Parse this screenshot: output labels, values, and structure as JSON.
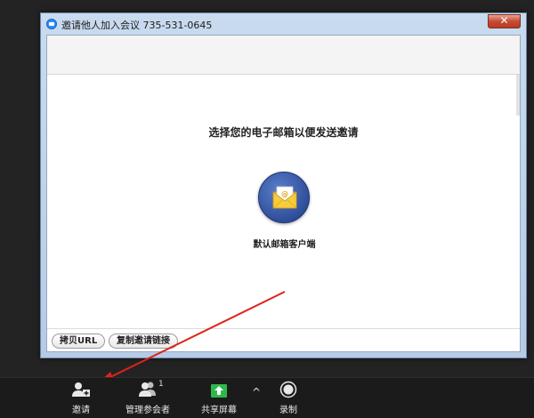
{
  "dialog": {
    "title": "邀请他人加入会议 735-531-0645",
    "close_label": "✕",
    "prompt": "选择您的电子邮箱以便发送邀请",
    "mail_client_label": "默认邮箱客户端",
    "copy_url_label": "拷贝URL",
    "copy_link_label": "复制邀请链接"
  },
  "toolbar": {
    "invite_label": "邀请",
    "participants_label": "管理参会者",
    "participants_count": "1",
    "share_label": "共享屏幕",
    "record_label": "录制",
    "share_caret": "^"
  },
  "colors": {
    "toolbar_bg": "#1b1b1b",
    "share_green": "#2fb84a",
    "annotation_red": "#e0221a",
    "mail_button_blue": "#2f4e9b"
  },
  "icons": [
    "zoom-logo-icon",
    "close-icon",
    "envelope-icon",
    "add-user-icon",
    "participants-icon",
    "share-screen-icon",
    "record-icon",
    "chevron-up-icon"
  ]
}
